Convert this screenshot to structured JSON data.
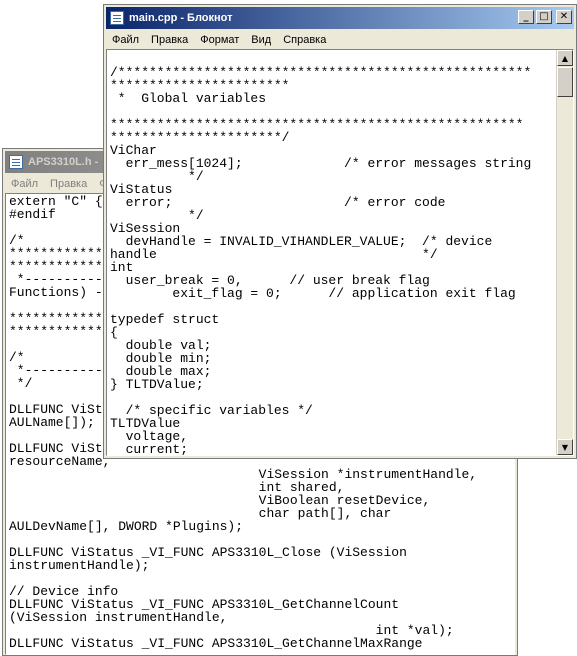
{
  "back_window": {
    "title": "APS3310L.h -",
    "menu": [
      "Файл",
      "Правка",
      "Ф"
    ],
    "code": "extern \"C\" {\n#endif\n\n/*\n*************\n*************\n *-----------\nFunctions) -\n\n*************\n*************\n\n/*\n *-----------\n */\n\nDLLFUNC ViSt\nAULName[]);\n\nDLLFUNC ViSt\nresourceName,\n                                ViSession *instrumentHandle,\n                                int shared,\n                                ViBoolean resetDevice,\n                                char path[], char\nAULDevName[], DWORD *Plugins);\n\nDLLFUNC ViStatus _VI_FUNC APS3310L_Close (ViSession\ninstrumentHandle);\n\n// Device info\nDLLFUNC ViStatus _VI_FUNC APS3310L_GetChannelCount\n(ViSession instrumentHandle,\n                                               int *val);\nDLLFUNC ViStatus _VI_FUNC APS3310L_GetChannelMaxRange"
  },
  "front_window": {
    "title": "main.cpp - Блокнот",
    "menu": [
      "Файл",
      "Правка",
      "Формат",
      "Вид",
      "Справка"
    ],
    "code": "\n/*****************************************************\n***********************\n *  Global variables\n\n*****************************************************\n**********************/\nViChar\n  err_mess[1024];             /* error messages string\n          */\nViStatus\n  error;                      /* error code\n          */\nViSession\n  devHandle = INVALID_VIHANDLER_VALUE;  /* device\nhandle                                  */\nint\n  user_break = 0,      // user break flag\n        exit_flag = 0;      // application exit flag\n\ntypedef struct\n{\n  double val;\n  double min;\n  double max;\n} TLTDValue;\n\n  /* specific variables */\nTLTDValue\n  voltage,\n  current;"
  },
  "icons": {
    "minimize": "minimize-icon",
    "maximize": "maximize-icon",
    "close": "close-icon",
    "scroll_up": "scroll-up-arrow-icon",
    "scroll_down": "scroll-down-arrow-icon"
  },
  "colors": {
    "active_title_start": "#0a246a",
    "active_title_end": "#a6caf0",
    "inactive_title_start": "#808080",
    "inactive_title_end": "#c0c0c0",
    "window_face": "#ece9d8"
  }
}
